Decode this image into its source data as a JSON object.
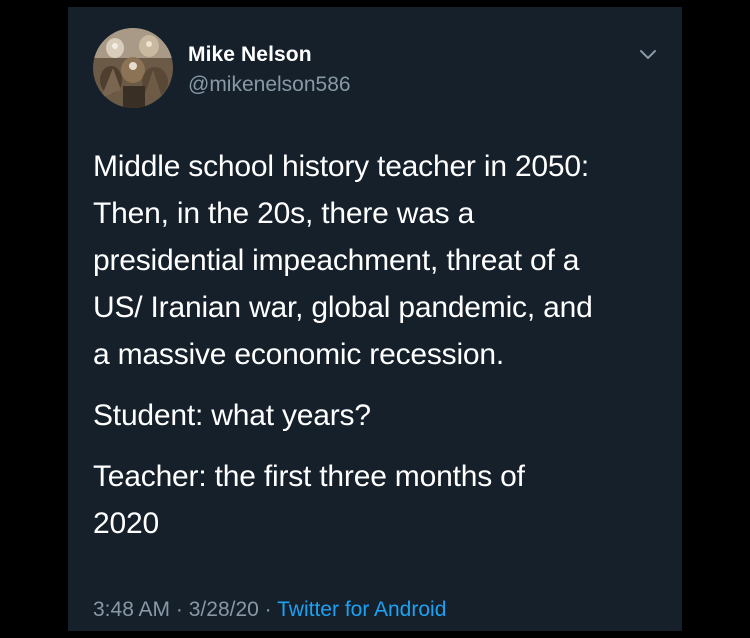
{
  "tweet": {
    "author": {
      "name": "Mike Nelson",
      "handle": "@mikenelson586"
    },
    "paragraphs": [
      "Middle school history teacher in 2050:\nThen, in the 20s, there was a\npresidential impeachment, threat of a\nUS/ Iranian war, global pandemic, and\na massive economic recession.",
      "Student: what years?",
      "Teacher: the first three months of\n2020"
    ],
    "time": "3:48 AM",
    "date": "3/28/20",
    "separator": "·",
    "source": "Twitter for Android"
  },
  "colors": {
    "background": "#15202b",
    "text": "#ffffff",
    "secondary": "#8899a6",
    "accent": "#1da1f2"
  },
  "icons": {
    "avatar": "avatar-image",
    "menu": "chevron-down-icon"
  }
}
